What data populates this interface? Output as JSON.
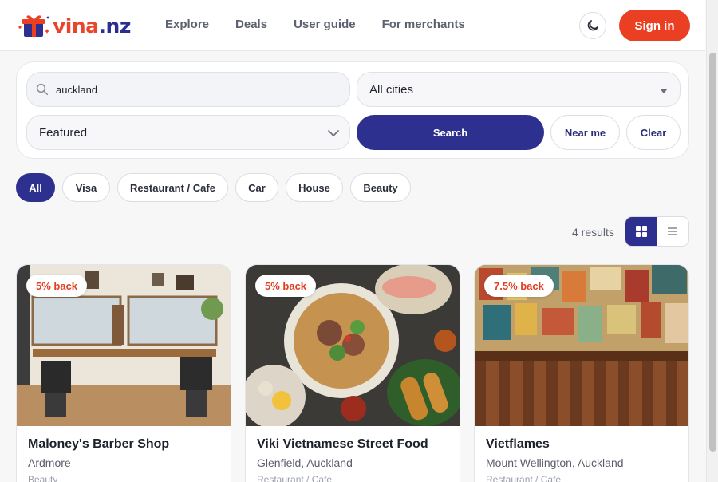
{
  "header": {
    "logo_part1": "vina",
    "logo_part2": ".nz",
    "nav": [
      {
        "label": "Explore"
      },
      {
        "label": "Deals"
      },
      {
        "label": "User guide"
      },
      {
        "label": "For merchants"
      }
    ],
    "theme_icon": "moon-icon",
    "signin_label": "Sign in"
  },
  "search": {
    "query": "auckland",
    "city_value": "All cities",
    "sort_value": "Featured",
    "search_label": "Search",
    "near_label": "Near me",
    "clear_label": "Clear"
  },
  "categories": [
    {
      "label": "All",
      "active": true
    },
    {
      "label": "Visa"
    },
    {
      "label": "Restaurant / Cafe"
    },
    {
      "label": "Car"
    },
    {
      "label": "House"
    },
    {
      "label": "Beauty"
    }
  ],
  "results": {
    "count_text": "4 results",
    "view_mode": "grid"
  },
  "cards": [
    {
      "badge": "5% back",
      "title": "Maloney's Barber Shop",
      "location": "Ardmore",
      "category": "Beauty"
    },
    {
      "badge": "5% back",
      "title": "Viki Vietnamese Street Food",
      "location": "Glenfield, Auckland",
      "category": "Restaurant / Cafe"
    },
    {
      "badge": "7.5% back",
      "title": "Vietflames",
      "location": "Mount Wellington, Auckland",
      "category": "Restaurant / Cafe"
    }
  ],
  "colors": {
    "brand_red": "#ea3f23",
    "brand_navy": "#2e3090"
  }
}
